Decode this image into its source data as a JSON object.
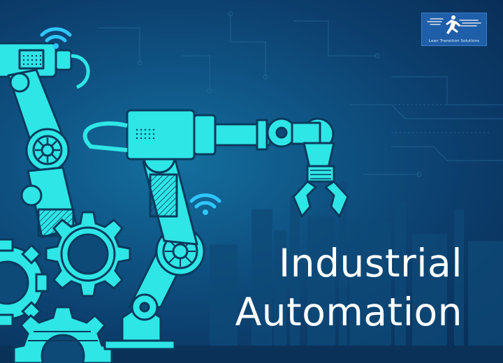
{
  "logo": {
    "text": "Lean Transition Solutions",
    "icon": "running-man-icon"
  },
  "headline": {
    "line1": "Industrial",
    "line2": "Automation"
  },
  "colors": {
    "background": "#0c3f6e",
    "accent": "#2ee6e6",
    "outline": "#0a3a5e",
    "wifi": "#2ec7ff",
    "text": "#ffffff"
  }
}
